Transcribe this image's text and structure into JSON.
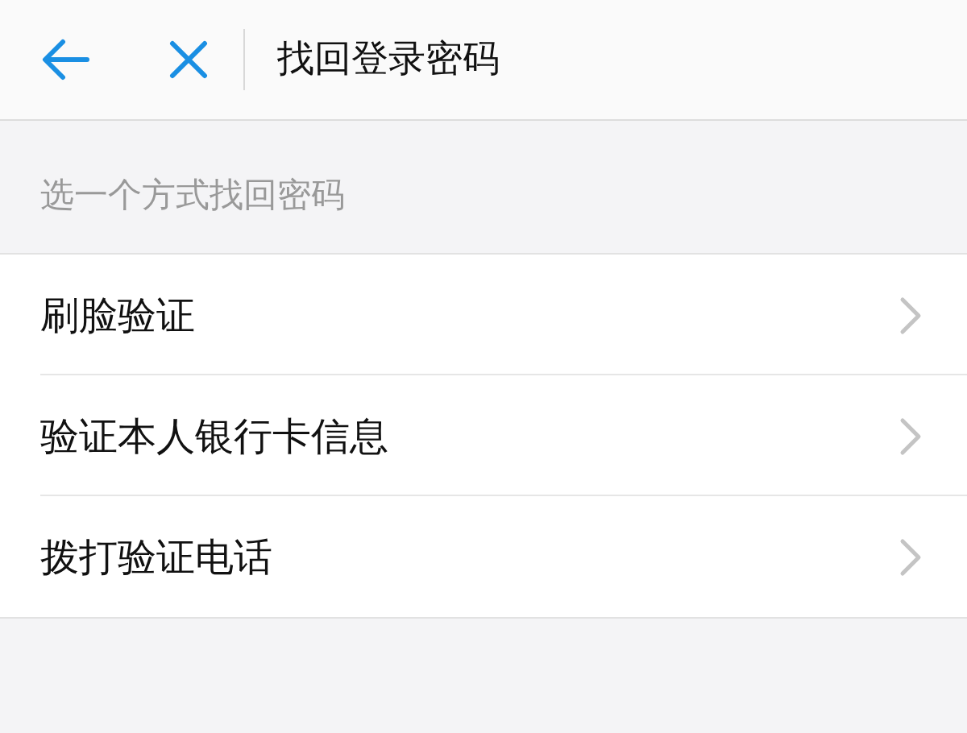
{
  "header": {
    "title": "找回登录密码"
  },
  "section": {
    "heading": "选一个方式找回密码"
  },
  "options": [
    {
      "label": "刷脸验证"
    },
    {
      "label": "验证本人银行卡信息"
    },
    {
      "label": "拨打验证电话"
    }
  ]
}
